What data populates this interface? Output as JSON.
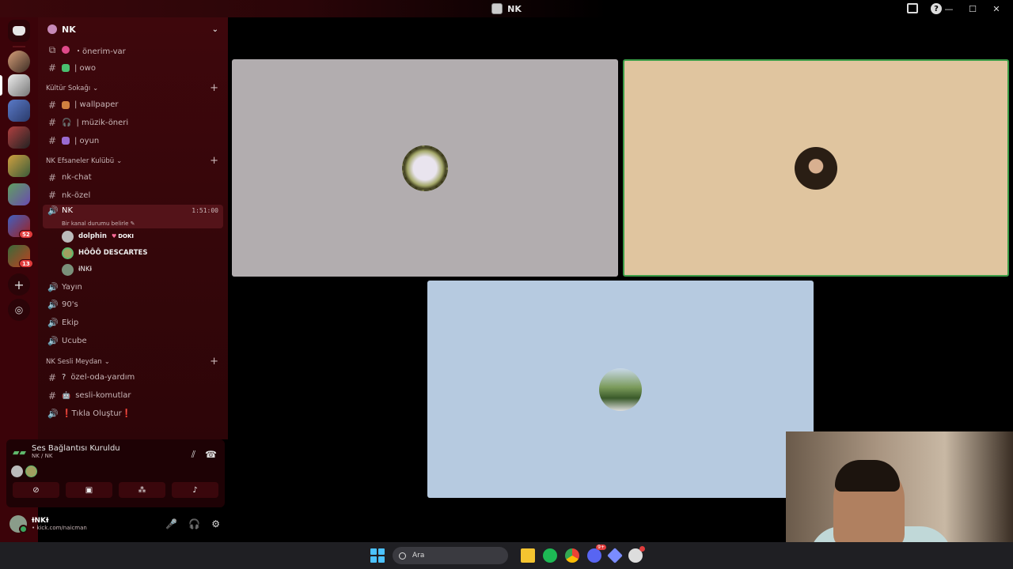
{
  "window": {
    "title": "NK"
  },
  "server": {
    "name": "NK"
  },
  "channels": {
    "top": [
      {
        "label": "・önerim-var",
        "icon": "forum-icon"
      },
      {
        "label": "| owo",
        "icon": "hash-icon"
      }
    ],
    "cat1": {
      "label": "Kültür Sokağı",
      "items": [
        "| wallpaper",
        "| müzik-öneri",
        "| oyun"
      ]
    },
    "cat2": {
      "label": "NK Efsaneler Kulübü",
      "items": [
        "nk-chat",
        "nk-özel"
      ],
      "active_voice": {
        "name": "NK",
        "timer": "1:51:00",
        "status": "Bir kanal durumu belirle"
      },
      "members": [
        {
          "name": "dolphin",
          "tag": "DOKI"
        },
        {
          "name": "HÔÔÔ DESCARTES"
        },
        {
          "name": "ƗNKƗ"
        }
      ],
      "voice_channels": [
        "Yayın",
        "90's",
        "Ekip",
        "Ucube"
      ]
    },
    "cat3": {
      "label": "NK Sesli Meydan",
      "items": [
        "özel-oda-yardım",
        "sesli-komutlar",
        "❗Tıkla Oluştur❗"
      ]
    }
  },
  "rail": {
    "badges": [
      "52",
      "13"
    ]
  },
  "voice_status": {
    "title": "Ses Bağlantısı Kuruldu",
    "subtitle": "NK / NK"
  },
  "user": {
    "name": "ƗNKƗ",
    "status": "• kick.com/naicman"
  },
  "taskbar": {
    "search_placeholder": "Ara",
    "discord_badge": "9+"
  }
}
